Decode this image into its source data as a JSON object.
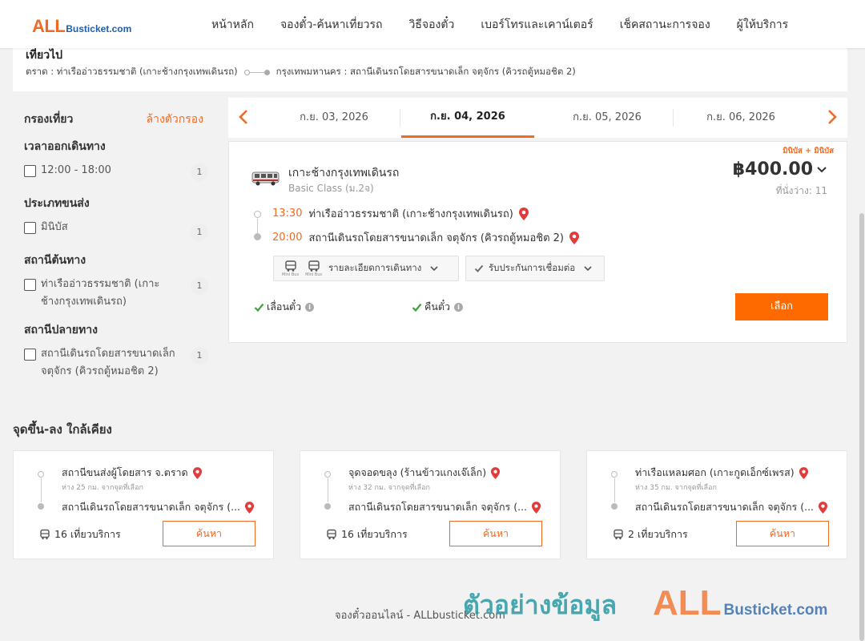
{
  "header": {
    "logo_big": "ALL",
    "logo_small": "Busticket.com",
    "nav": [
      "หน้าหลัก",
      "จองตั๋ว-ค้นหาเที่ยวรถ",
      "วิธีจองตั๋ว",
      "เบอร์โทรและเคาน์เตอร์",
      "เช็คสถานะการจอง",
      "ผู้ให้บริการ"
    ]
  },
  "trip": {
    "title": "เที่ยวไป",
    "origin": "ตราด : ท่าเรืออ่าวธรรมชาติ (เกาะช้างกรุงเทพเดินรถ)",
    "destination": "กรุงเทพมหานคร : สถานีเดินรถโดยสารขนาดเล็ก จตุจักร (คิวรถตู้หมอชิต 2)"
  },
  "filter": {
    "title": "กรองเที่ยว",
    "clear": "ล้างตัวกรอง",
    "groups": [
      {
        "title": "เวลาออกเดินทาง",
        "option": "12:00 - 18:00",
        "count": "1"
      },
      {
        "title": "ประเภทขนส่ง",
        "option": "มินิบัส",
        "count": "1"
      },
      {
        "title": "สถานีต้นทาง",
        "option": "ท่าเรืออ่าวธรรมชาติ (เกาะช้างกรุงเทพเดินรถ)",
        "count": "1"
      },
      {
        "title": "สถานีปลายทาง",
        "option": "สถานีเดินรถโดยสารขนาดเล็ก จตุจักร (คิวรถตู้หมอชิต 2)",
        "count": "1"
      }
    ]
  },
  "dates": [
    "ก.ย. 03, 2026",
    "ก.ย. 04, 2026",
    "ก.ย. 05, 2026",
    "ก.ย. 06, 2026"
  ],
  "selected_date_index": 1,
  "result": {
    "tag": "มินิบัส + มินิบัส",
    "operator": "เกาะช้างกรุงเทพเดินรถ",
    "class": "Basic Class (ม.2จ)",
    "price": "฿400.00",
    "seats": "ที่นั่งว่าง: 11",
    "depart_time": "13:30",
    "depart_place": "ท่าเรืออ่าวธรรมชาติ (เกาะช้างกรุงเทพเดินรถ)",
    "arrive_time": "20:00",
    "arrive_place": "สถานีเดินรถโดยสารขนาดเล็ก จตุจักร (คิวรถตู้หมอชิต 2)",
    "mini_bus_label": "Mini Bus",
    "details_label": "รายละเอียดการเดินทาง",
    "guarantee_label": "รับประกันการเชื่อมต่อ",
    "feature_1": "เลื่อนตั๋ว",
    "feature_2": "คืนตั๋ว",
    "select_label": "เลือก"
  },
  "nearby": {
    "title": "จุดขึ้น-ลง ใกล้เคียง",
    "search_label": "ค้นหา",
    "cards": [
      {
        "from": "สถานีขนส่งผู้โดยสาร จ.ตราด",
        "distance": "ห่าง 25 กม. จากจุดที่เลือก",
        "to": "สถานีเดินรถโดยสารขนาดเล็ก จตุจักร (...",
        "trips": "16 เที่ยวบริการ"
      },
      {
        "from": "จุดจอดขลุง (ร้านข้าวแกงเจ๊เล็ก)",
        "distance": "ห่าง 32 กม. จากจุดที่เลือก",
        "to": "สถานีเดินรถโดยสารขนาดเล็ก จตุจักร (...",
        "trips": "16 เที่ยวบริการ"
      },
      {
        "from": "ท่าเรือแหลมศอก (เกาะกูดเอ็กซ์เพรส)",
        "distance": "ห่าง 35 กม. จากจุดที่เลือก",
        "to": "สถานีเดินรถโดยสารขนาดเล็ก จตุจักร (...",
        "trips": "2 เที่ยวบริการ"
      }
    ]
  },
  "footer": {
    "text": "จองตั๋วออนไลน์ - ALLbusticket.com",
    "watermark_text": "ตัวอย่างข้อมูล",
    "watermark_logo_big": "ALL",
    "watermark_logo_small": "Busticket.com"
  },
  "colors": {
    "accent": "#f26a21",
    "button": "#ff6a00",
    "brand_blue": "#1f5ea8",
    "check_green": "#3aa33a",
    "pin_red": "#e23b3b"
  }
}
